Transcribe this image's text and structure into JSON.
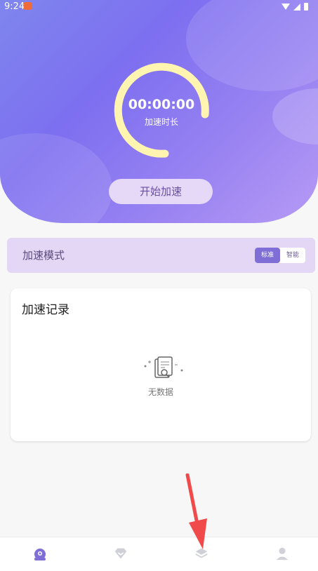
{
  "status_bar": {
    "time": "9:24"
  },
  "timer": {
    "value": "00:00:00",
    "label": "加速时长"
  },
  "start_button": {
    "label": "开始加速"
  },
  "mode": {
    "title": "加速模式",
    "options": [
      "标准",
      "智能"
    ],
    "selected": "标准"
  },
  "records": {
    "title": "加速记录",
    "empty_text": "无数据"
  },
  "bottom_nav": {
    "items": [
      {
        "icon": "robot-icon",
        "active": true
      },
      {
        "icon": "heart-icon",
        "active": false
      },
      {
        "icon": "layers-icon",
        "active": false
      },
      {
        "icon": "user-icon",
        "active": false
      }
    ]
  },
  "colors": {
    "accent": "#7f6ed6",
    "ring": "#fff4b0",
    "annotation_arrow": "#f04a4a"
  }
}
